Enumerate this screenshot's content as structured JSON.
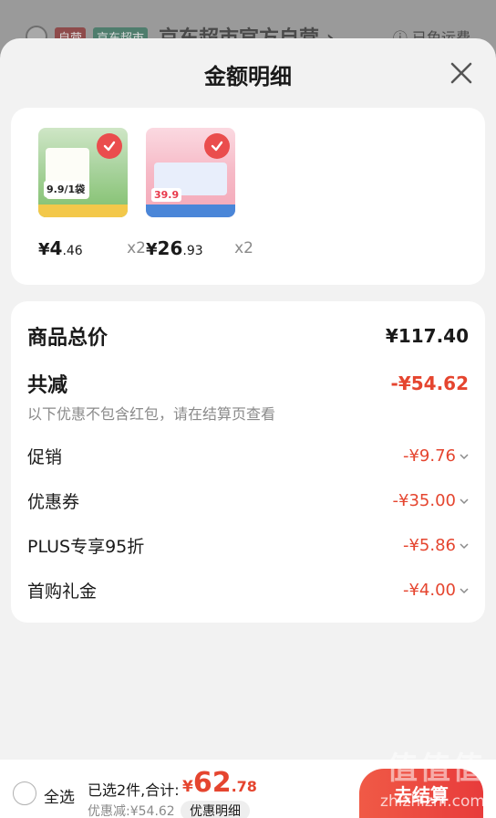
{
  "background": {
    "tags": [
      "自营",
      "京东超市"
    ],
    "store_name": "京东超市官方自营 ›",
    "shipping": "已免运费"
  },
  "sheet": {
    "title": "金额明细"
  },
  "products": [
    {
      "thumb_price": "9.9/1袋",
      "price_yen": "¥",
      "price_int": "4",
      "price_dec": ".46",
      "qty": "x2"
    },
    {
      "thumb_price": "39.9",
      "price_yen": "¥",
      "price_int": "26",
      "price_dec": ".93",
      "qty": "x2"
    }
  ],
  "summary": {
    "total_label": "商品总价",
    "total_value": "¥117.40",
    "reduce_label": "共减",
    "reduce_value": "-¥54.62",
    "hint": "以下优惠不包含红包，请在结算页查看",
    "items": [
      {
        "label": "促销",
        "value": "-¥9.76"
      },
      {
        "label": "优惠券",
        "value": "-¥35.00"
      },
      {
        "label": "PLUS专享95折",
        "value": "-¥5.86"
      },
      {
        "label": "首购礼金",
        "value": "-¥4.00"
      }
    ]
  },
  "bottom": {
    "select_all": "全选",
    "selected_count": "已选2件,合计:",
    "total_yen": "¥",
    "total_int": "62",
    "total_dec": ".78",
    "discount": "优惠减:¥54.62",
    "detail_button": "优惠明细",
    "checkout_button": "去结算"
  },
  "watermark": {
    "text": "值值值",
    "url": "zhizhizhi.com"
  },
  "colors": {
    "accent_red": "#e5452f",
    "sheet_bg": "#f2f2f2",
    "card_bg": "#ffffff"
  }
}
